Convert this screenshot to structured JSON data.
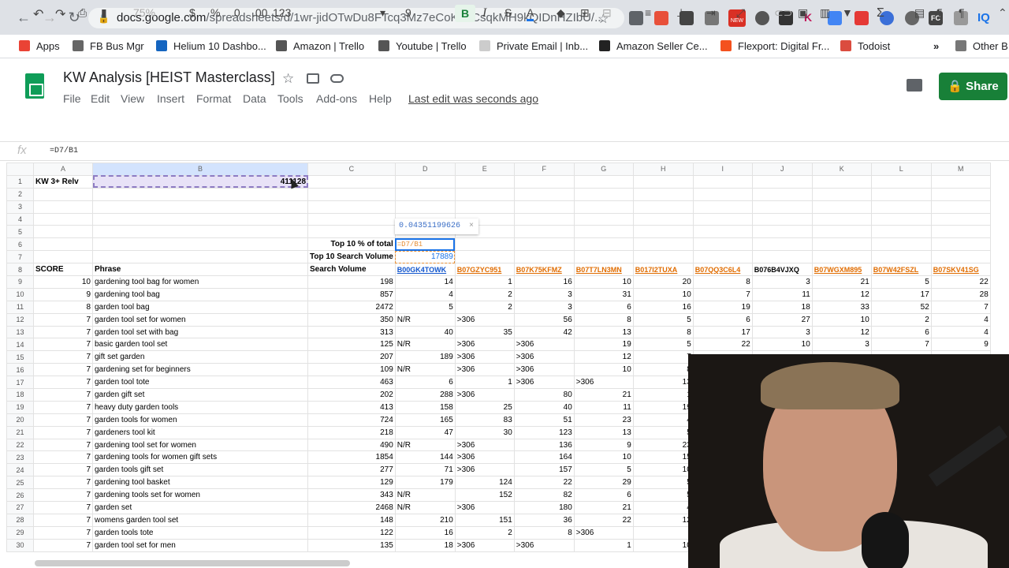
{
  "browser": {
    "url_domain": "docs.google.com",
    "url_path": "/spreadsheets/d/1wr-jidOTwDu8FTcq3Mz7eCoK7LCsqkMH9kQIDnHZIbU/...",
    "badge_new": "NEW",
    "ext_labels": [
      "K",
      "FC",
      "IQ"
    ]
  },
  "bookmarks": [
    "Apps",
    "FB Bus Mgr",
    "Helium 10 Dashbo...",
    "Amazon | Trello",
    "Youtube | Trello",
    "Private Email | Inb...",
    "Amazon Seller Ce...",
    "Flexport: Digital Fr...",
    "Todoist",
    "»",
    "Other B"
  ],
  "doc": {
    "title": "KW Analysis [HEIST Masterclass]",
    "menus": [
      "File",
      "Edit",
      "View",
      "Insert",
      "Format",
      "Data",
      "Tools",
      "Add-ons",
      "Help"
    ],
    "last_edit": "Last edit was seconds ago",
    "share_label": "Share"
  },
  "toolbar": {
    "zoom": "75%",
    "currency": "$",
    "percent": "%",
    "dec_less": ".0",
    "dec_more": ".00",
    "format": "123",
    "font_size": "9",
    "bold": "B",
    "italic": "I",
    "strike": "S",
    "text_color": "A",
    "sum": "Σ"
  },
  "formula": {
    "fx": "fx",
    "value": "=D7/B1"
  },
  "tooltip": {
    "value": "0.04351199626",
    "close": "×"
  },
  "columns": [
    "A",
    "B",
    "C",
    "D",
    "E",
    "F",
    "G",
    "H",
    "I",
    "J",
    "K",
    "L",
    "M"
  ],
  "row1": {
    "a": "KW 3+ Relv",
    "b": "411128"
  },
  "row6": {
    "c": "Top 10 % of total",
    "d": "=D7/B1"
  },
  "row7": {
    "c": "Top 10 Search Volume",
    "d": "17889"
  },
  "row8": {
    "a": "SCORE",
    "b": "Phrase",
    "c": "Search Volume",
    "asins": [
      "B00GK4TOWK",
      "B07GZYC951",
      "B07K75KFMZ",
      "B07T7LN3MN",
      "B017I2TUXA",
      "B07QQ3C6L4",
      "B076B4VJXQ",
      "B07WGXM895",
      "B07W42FSZL",
      "B07SKV41SG"
    ]
  },
  "rows": [
    [
      "10",
      "gardening tool bag for women",
      "198",
      "14",
      "1",
      "16",
      "10",
      "20",
      "8",
      "3",
      "21",
      "5",
      "22"
    ],
    [
      "9",
      "gardening tool bag",
      "857",
      "4",
      "2",
      "3",
      "31",
      "10",
      "7",
      "11",
      "12",
      "17",
      "28"
    ],
    [
      "8",
      "garden tool bag",
      "2472",
      "5",
      "2",
      "3",
      "6",
      "16",
      "19",
      "18",
      "33",
      "52",
      "7"
    ],
    [
      "7",
      "garden tool set for women",
      "350",
      "N/R",
      ">306",
      "56",
      "8",
      "5",
      "6",
      "27",
      "10",
      "2",
      "4"
    ],
    [
      "7",
      "garden tool set with bag",
      "313",
      "40",
      "35",
      "42",
      "13",
      "8",
      "17",
      "3",
      "12",
      "6",
      "4"
    ],
    [
      "7",
      "basic garden tool set",
      "125",
      "N/R",
      ">306",
      ">306",
      "19",
      "5",
      "22",
      "10",
      "3",
      "7",
      "9"
    ],
    [
      "7",
      "gift set garden",
      "207",
      "189",
      ">306",
      ">306",
      "12",
      "7",
      "",
      "",
      "",
      "",
      ""
    ],
    [
      "7",
      "gardening set for beginners",
      "109",
      "N/R",
      ">306",
      ">306",
      "10",
      "8",
      "",
      "",
      "",
      "",
      ""
    ],
    [
      "7",
      "garden tool tote",
      "463",
      "6",
      "1",
      ">306",
      ">306",
      "13",
      "",
      "",
      "",
      "",
      ""
    ],
    [
      "7",
      "garden gift set",
      "202",
      "288",
      ">306",
      "80",
      "21",
      "1",
      "",
      "",
      "",
      "",
      ""
    ],
    [
      "7",
      "heavy duty garden tools",
      "413",
      "158",
      "25",
      "40",
      "11",
      "19",
      "",
      "",
      "",
      "",
      ""
    ],
    [
      "7",
      "garden tools for women",
      "724",
      "165",
      "83",
      "51",
      "23",
      "4",
      "",
      "",
      "",
      "",
      ""
    ],
    [
      "7",
      "gardeners tool kit",
      "218",
      "47",
      "30",
      "123",
      "13",
      "5",
      "",
      "",
      "",
      "",
      ""
    ],
    [
      "7",
      "gardening tool set for women",
      "490",
      "N/R",
      ">306",
      "136",
      "9",
      "23",
      "",
      "",
      "",
      "",
      ""
    ],
    [
      "7",
      "gardening tools for women gift sets",
      "1854",
      "144",
      ">306",
      "164",
      "10",
      "15",
      "",
      "",
      "",
      "",
      ""
    ],
    [
      "7",
      "garden tools gift set",
      "277",
      "71",
      ">306",
      "157",
      "5",
      "10",
      "",
      "",
      "",
      "",
      ""
    ],
    [
      "7",
      "gardening tool basket",
      "129",
      "179",
      "124",
      "22",
      "29",
      "5",
      "",
      "",
      "",
      "",
      ""
    ],
    [
      "7",
      "gardening tools set for women",
      "343",
      "N/R",
      "152",
      "82",
      "6",
      "5",
      "",
      "",
      "",
      "",
      ""
    ],
    [
      "7",
      "garden set",
      "2468",
      "N/R",
      ">306",
      "180",
      "21",
      "4",
      "",
      "",
      "",
      "",
      ""
    ],
    [
      "7",
      "womens garden tool set",
      "148",
      "210",
      "151",
      "36",
      "22",
      "12",
      "",
      "",
      "",
      "",
      ""
    ],
    [
      "7",
      "garden tools tote",
      "122",
      "16",
      "2",
      "8",
      ">306",
      "",
      "",
      "",
      "",
      "",
      ""
    ],
    [
      "7",
      "garden tool set for men",
      "135",
      "18",
      ">306",
      ">306",
      "1",
      "10",
      "",
      "",
      "",
      "",
      ""
    ]
  ],
  "colors": {
    "share": "#188038",
    "sheets_green": "#0f9d58",
    "asin_blue": "#1155cc",
    "asin_orange": "#e06c00"
  }
}
